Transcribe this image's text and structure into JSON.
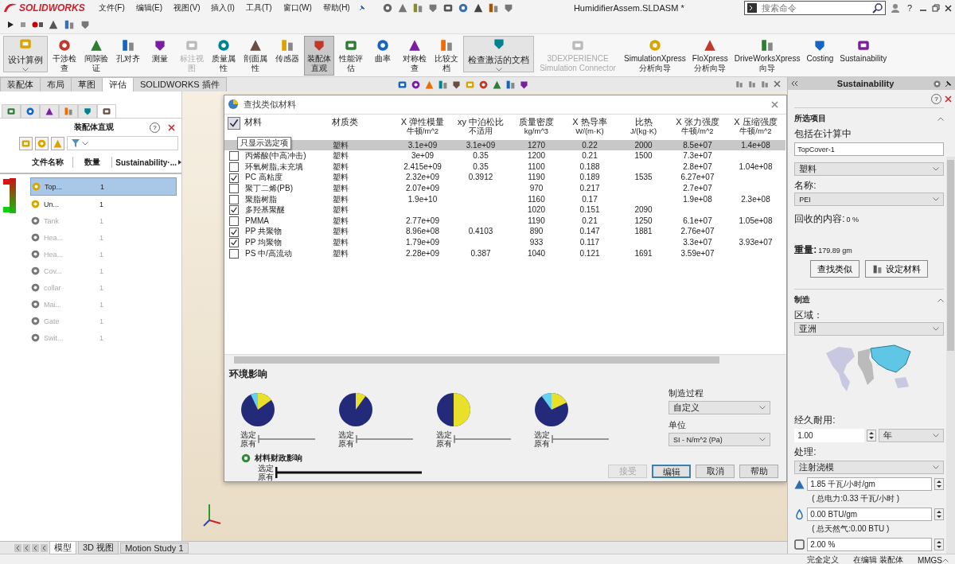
{
  "menu_bar": {
    "logo": "SOLIDWORKS",
    "menus": [
      "文件(F)",
      "编辑(E)",
      "视图(V)",
      "插入(I)",
      "工具(T)",
      "窗口(W)",
      "帮助(H)"
    ],
    "document_title": "HumidifierAssem.SLDASM *",
    "search": {
      "placeholder": "搜索命令"
    },
    "help": "?"
  },
  "ribbon": [
    {
      "label": "设计算例",
      "kind": "dropdown",
      "disabled": false,
      "selected": false
    },
    {
      "label": "干涉检查",
      "kind": "button",
      "disabled": false,
      "selected": false
    },
    {
      "label": "间隙验证",
      "kind": "button",
      "disabled": false,
      "selected": false
    },
    {
      "label": "孔对齐",
      "kind": "button",
      "disabled": false,
      "selected": false
    },
    {
      "label": "测量",
      "kind": "button",
      "disabled": false,
      "selected": false
    },
    {
      "label": "标注视图",
      "kind": "button",
      "disabled": true,
      "selected": false
    },
    {
      "label": "质量属性",
      "kind": "button",
      "disabled": false,
      "selected": false
    },
    {
      "label": "剖面属性",
      "kind": "button",
      "disabled": false,
      "selected": false
    },
    {
      "label": "传感器",
      "kind": "button",
      "disabled": false,
      "selected": false
    },
    {
      "label": "装配体直观",
      "kind": "button",
      "disabled": false,
      "selected": true
    },
    {
      "label": "性能评估",
      "kind": "button",
      "disabled": false,
      "selected": false
    },
    {
      "label": "曲率",
      "kind": "button",
      "disabled": false,
      "selected": false
    },
    {
      "label": "对称检查",
      "kind": "button",
      "disabled": false,
      "selected": false
    },
    {
      "label": "比较文档",
      "kind": "button",
      "disabled": false,
      "selected": false
    },
    {
      "label": "检查激活的文档",
      "kind": "dropdown",
      "disabled": false,
      "selected": false
    },
    {
      "label": "3DEXPERIENCE Simulation Connector",
      "kind": "button",
      "disabled": true,
      "selected": false
    },
    {
      "label": "SimulationXpress 分析向导",
      "kind": "button",
      "disabled": false,
      "selected": false
    },
    {
      "label": "FloXpress 分析向导",
      "kind": "button",
      "disabled": false,
      "selected": false
    },
    {
      "label": "DriveWorksXpress 向导",
      "kind": "button",
      "disabled": false,
      "selected": false
    },
    {
      "label": "Costing",
      "kind": "button",
      "disabled": false,
      "selected": false
    },
    {
      "label": "Sustainability",
      "kind": "button",
      "disabled": false,
      "selected": false
    }
  ],
  "command_tabs": [
    {
      "label": "装配体",
      "selected": false
    },
    {
      "label": "布局",
      "selected": false
    },
    {
      "label": "草图",
      "selected": false
    },
    {
      "label": "评估",
      "selected": true
    },
    {
      "label": "SOLIDWORKS 插件",
      "selected": false
    }
  ],
  "assembly_visualization": {
    "panel_tabs": [
      {
        "selected": false
      },
      {
        "selected": false
      },
      {
        "selected": false
      },
      {
        "selected": false
      },
      {
        "selected": false
      },
      {
        "selected": true
      }
    ],
    "title": "装配体直观",
    "help": "?",
    "columns": [
      "文件名称",
      "数量",
      "Sustainability·..."
    ],
    "rows": [
      {
        "name": "Top...",
        "count": "1",
        "active": true,
        "selected": true
      },
      {
        "name": "Un...",
        "count": "1",
        "active": true,
        "selected": false
      },
      {
        "name": "Tank",
        "count": "1",
        "active": false,
        "selected": false
      },
      {
        "name": "Hea...",
        "count": "1",
        "active": false,
        "selected": false
      },
      {
        "name": "Hea...",
        "count": "1",
        "active": false,
        "selected": false
      },
      {
        "name": "Cov...",
        "count": "1",
        "active": false,
        "selected": false
      },
      {
        "name": "collar",
        "count": "1",
        "active": false,
        "selected": false
      },
      {
        "name": "Mai...",
        "count": "1",
        "active": false,
        "selected": false
      },
      {
        "name": "Gate",
        "count": "1",
        "active": false,
        "selected": false
      },
      {
        "name": "Swit...",
        "count": "1",
        "active": false,
        "selected": false
      }
    ]
  },
  "dialog": {
    "title": "查找类似材料",
    "show_selected_only": true,
    "tooltip": "只显示选定项",
    "columns": [
      {
        "title": "材料"
      },
      {
        "title": "材质类"
      },
      {
        "title": "X 弹性模量",
        "unit": "牛顿/m^2"
      },
      {
        "title": "xy 中泊松比",
        "unit": "不适用"
      },
      {
        "title": "质量密度",
        "unit": "kg/m^3"
      },
      {
        "title": "X 热导率",
        "unit": "W/(m·K)"
      },
      {
        "title": "比热",
        "unit": "J/(kg·K)"
      },
      {
        "title": "X 张力强度",
        "unit": "牛顿/m^2"
      },
      {
        "title": "X 压缩强度",
        "unit": "牛顿/m^2"
      }
    ],
    "rows": [
      {
        "selected": true,
        "class": "塑料",
        "elastic_modulus": "3.1e+09",
        "poisson_ratio": "3.1e+09",
        "density": "1270",
        "thermal_conductivity": "0.22",
        "specific_heat": "2000",
        "tensile_strength": "8.5e+07",
        "compressive_strength": "1.4e+08"
      },
      {
        "selected": false,
        "checked": false,
        "material": "丙烯酸(中高冲击)",
        "class": "塑料",
        "elastic_modulus": "3e+09",
        "poisson_ratio": "0.35",
        "density": "1200",
        "thermal_conductivity": "0.21",
        "specific_heat": "1500",
        "tensile_strength": "7.3e+07"
      },
      {
        "selected": false,
        "checked": false,
        "material": "环氧树脂,未充填",
        "class": "塑料",
        "elastic_modulus": "2.415e+09",
        "poisson_ratio": "0.35",
        "density": "1100",
        "thermal_conductivity": "0.188",
        "tensile_strength": "2.8e+07",
        "compressive_strength": "1.04e+08"
      },
      {
        "selected": false,
        "checked": true,
        "material": "PC 高粘度",
        "class": "塑料",
        "elastic_modulus": "2.32e+09",
        "poisson_ratio": "0.3912",
        "density": "1190",
        "thermal_conductivity": "0.189",
        "specific_heat": "1535",
        "tensile_strength": "6.27e+07"
      },
      {
        "selected": false,
        "checked": false,
        "material": "聚丁二烯(PB)",
        "class": "塑料",
        "elastic_modulus": "2.07e+09",
        "density": "970",
        "thermal_conductivity": "0.217",
        "tensile_strength": "2.7e+07"
      },
      {
        "selected": false,
        "checked": false,
        "material": "聚脂树脂",
        "class": "塑料",
        "elastic_modulus": "1.9e+10",
        "density": "1160",
        "thermal_conductivity": "0.17",
        "tensile_strength": "1.9e+08",
        "compressive_strength": "2.3e+08"
      },
      {
        "selected": false,
        "checked": true,
        "material": "多羟基聚醚",
        "class": "塑料",
        "density": "1020",
        "thermal_conductivity": "0.151",
        "specific_heat": "2090"
      },
      {
        "selected": false,
        "checked": false,
        "material": "PMMA",
        "class": "塑料",
        "elastic_modulus": "2.77e+09",
        "density": "1190",
        "thermal_conductivity": "0.21",
        "specific_heat": "1250",
        "tensile_strength": "6.1e+07",
        "compressive_strength": "1.05e+08"
      },
      {
        "selected": false,
        "checked": true,
        "material": "PP 共聚物",
        "class": "塑料",
        "elastic_modulus": "8.96e+08",
        "poisson_ratio": "0.4103",
        "density": "890",
        "thermal_conductivity": "0.147",
        "specific_heat": "1881",
        "tensile_strength": "2.76e+07"
      },
      {
        "selected": false,
        "checked": true,
        "material": "PP 均聚物",
        "class": "塑料",
        "elastic_modulus": "1.79e+09",
        "density": "933",
        "thermal_conductivity": "0.117",
        "tensile_strength": "3.3e+07",
        "compressive_strength": "3.93e+07"
      },
      {
        "selected": false,
        "checked": false,
        "material": "PS 中/高流动",
        "class": "塑料",
        "elastic_modulus": "2.28e+09",
        "poisson_ratio": "0.387",
        "density": "1040",
        "thermal_conductivity": "0.121",
        "specific_heat": "1691",
        "tensile_strength": "3.59e+07"
      }
    ],
    "environment": {
      "title": "环境影响",
      "impacts": [
        {
          "selected_label": "选定",
          "original_label": "原有"
        },
        {
          "selected_label": "选定",
          "original_label": "原有"
        },
        {
          "selected_label": "选定",
          "original_label": "原有"
        },
        {
          "selected_label": "选定",
          "original_label": "原有"
        }
      ],
      "financial": {
        "title": "材料财政影响",
        "selected_label": "选定",
        "original_label": "原有"
      },
      "process": {
        "label": "制造过程",
        "value": "自定义"
      },
      "units": {
        "label": "单位",
        "value": "SI - N/m^2 (Pa)"
      }
    },
    "buttons": [
      {
        "label": "接受",
        "disabled": true,
        "default": false
      },
      {
        "label": "编辑",
        "disabled": false,
        "default": true
      },
      {
        "label": "取消",
        "disabled": false,
        "default": false
      },
      {
        "label": "帮助",
        "disabled": false,
        "default": false
      }
    ]
  },
  "sustainability": {
    "title": "Sustainability",
    "help": "?",
    "selection": {
      "title": "所选项目",
      "include_label": "包括在计算中",
      "component": "TopCover-1",
      "class": "塑料",
      "name_label": "名称:",
      "name": "PEI",
      "recycled_label": "回收的内容:",
      "recycled": "0 %",
      "weight_label": "重量:",
      "weight": "179.89 gm",
      "buttons": [
        "查找类似",
        "设定材料"
      ]
    },
    "manufacturing": {
      "title": "制造",
      "region_label": "区域：",
      "region": "亚洲",
      "use_label": "经久耐用:",
      "use_value": "1.00",
      "use_unit": "年",
      "process_label": "处理:",
      "process": "注射浇模",
      "energy": "1.85 千瓦/小时/gm",
      "energy_total": "( 总电力:0.33 千瓦/小时 )",
      "gas": "0.00 BTU/gm",
      "gas_total": "( 总天然气:0.00 BTU )",
      "scrap": "2.00 %"
    }
  },
  "bottom_tabs": [
    {
      "label": "模型",
      "selected": true
    },
    {
      "label": "3D 视图",
      "selected": false
    },
    {
      "label": "Motion Study 1",
      "selected": false
    }
  ],
  "status_bar": [
    "完全定义",
    "在编辑 装配体",
    "MMGS"
  ]
}
